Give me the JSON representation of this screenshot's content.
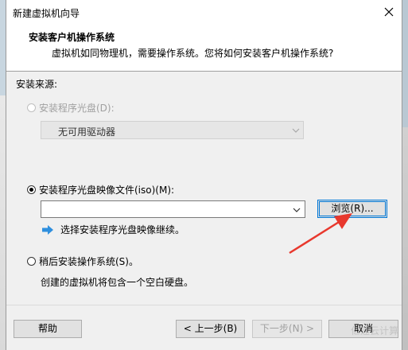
{
  "window": {
    "title": "新建虚拟机向导",
    "close_icon": "close-icon"
  },
  "header": {
    "title": "安装客户机操作系统",
    "subtitle": "虚拟机如同物理机，需要操作系统。您将如何安装客户机操作系统?"
  },
  "source": {
    "label": "安装来源:",
    "options": [
      {
        "label": "安装程序光盘(D):",
        "selected": false,
        "enabled": false
      },
      {
        "label": "安装程序光盘映像文件(iso)(M):",
        "selected": true,
        "enabled": true
      },
      {
        "label": "稍后安装操作系统(S)。",
        "selected": false,
        "enabled": true
      }
    ],
    "drive_combo_value": "无可用驱动器",
    "iso_path_value": "",
    "browse_label": "浏览(R)...",
    "iso_hint": "选择安装程序光盘映像继续。",
    "later_description": "创建的虚拟机将包含一个空白硬盘。"
  },
  "footer": {
    "help_label": "帮助",
    "back_label": "< 上一步(B)",
    "next_label": "下一步(N) >",
    "cancel_label": "取消"
  },
  "overlay": {
    "watermark": "亿速云计算",
    "annotation_arrow_color": "#e8382d"
  },
  "colors": {
    "focus_blue": "#0078d7",
    "info_arrow_blue": "#2f8fde"
  }
}
